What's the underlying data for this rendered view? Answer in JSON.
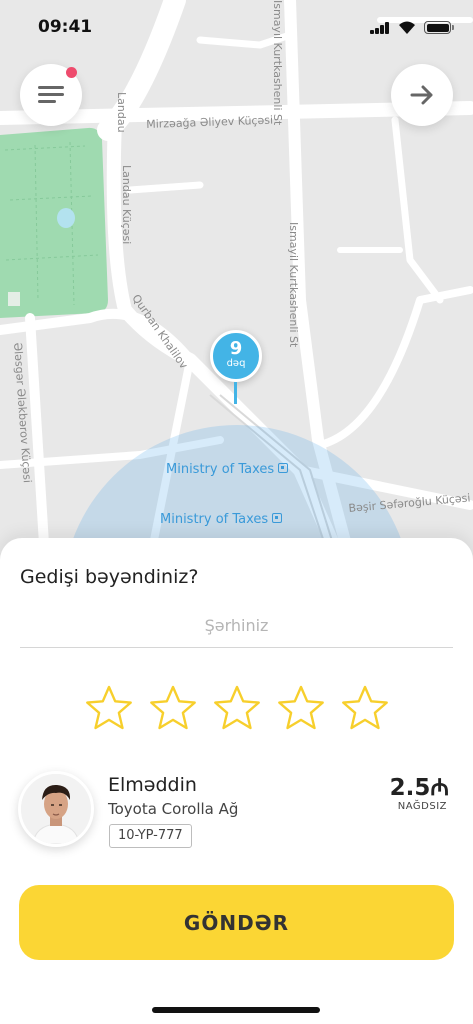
{
  "status_bar": {
    "time": "09:41"
  },
  "map": {
    "streets": [
      "Landau",
      "Landau Küçəsi",
      "Mirzəağa Əliyev Küçəsi",
      "Ismayıl Kurtkashenli St",
      "Ismayil Kurtkashenli St",
      "Qurban Khalilov",
      "Ələsgər Ələkbərov Küçəsi",
      "Bəşir Səfəroğlu Küçəsi"
    ],
    "pois": [
      "Ministry of Taxes",
      "Ministry of Taxes"
    ],
    "pin": {
      "number": "9",
      "unit": "dəq"
    }
  },
  "colors": {
    "accent_yellow": "#fbd634",
    "pin_blue": "#43b4e6",
    "park_green": "#9fdab0",
    "notification_dot": "#ee4b6d",
    "star_outline": "#f7cf2c"
  },
  "header": {
    "menu_icon": "hamburger-icon",
    "next_icon": "arrow-right-icon"
  },
  "feedback": {
    "title": "Gedişi bəyəndiniz?",
    "comment_placeholder": "Şərhiniz",
    "comment_value": "",
    "rating": 0,
    "rating_max": 5
  },
  "driver": {
    "name": "Elməddin",
    "car": "Toyota Corolla Ağ",
    "plate": "10-YP-777",
    "price": "2.5₼",
    "payment": "NAĞDSIZ"
  },
  "submit_label": "GÖNDƏR"
}
